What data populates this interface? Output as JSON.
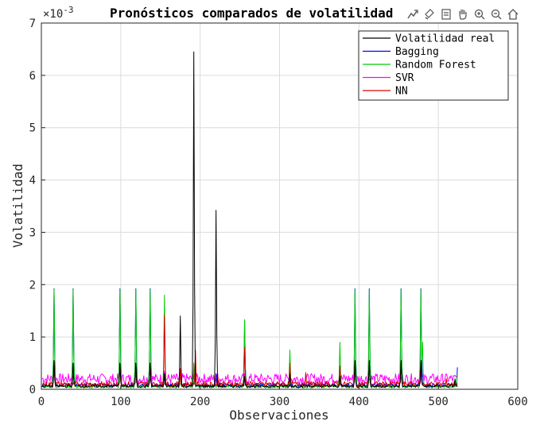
{
  "chart_data": {
    "type": "line",
    "title": "Pronósticos comparados de volatilidad",
    "xlabel": "Observaciones",
    "ylabel": "Volatilidad",
    "exponent_label": "×10",
    "exponent_power": "-3",
    "xlim": [
      0,
      600
    ],
    "ylim": [
      0,
      7
    ],
    "xticks": [
      "0",
      "100",
      "200",
      "300",
      "400",
      "500",
      "600"
    ],
    "yticks": [
      "0",
      "1",
      "2",
      "3",
      "4",
      "5",
      "6",
      "7"
    ],
    "grid": true,
    "legend_position": "top-right",
    "series": [
      {
        "name": "Volatilidad real",
        "color": "#000000",
        "baseline": 0.06,
        "n": 524,
        "spikes": [
          [
            16,
            0.55
          ],
          [
            40,
            0.5
          ],
          [
            99,
            0.5
          ],
          [
            119,
            0.5
          ],
          [
            137,
            0.5
          ],
          [
            155,
            0.3
          ],
          [
            175,
            1.4
          ],
          [
            192,
            6.45
          ],
          [
            220,
            3.42
          ],
          [
            256,
            0.25
          ],
          [
            313,
            0.3
          ],
          [
            376,
            0.25
          ],
          [
            395,
            0.55
          ],
          [
            413,
            0.55
          ],
          [
            453,
            0.55
          ],
          [
            478,
            0.55
          ],
          [
            521,
            0.2
          ]
        ]
      },
      {
        "name": "Bagging",
        "color": "#0000ff",
        "baseline": 0.08,
        "n": 524,
        "spikes": [
          [
            16,
            1.92
          ],
          [
            40,
            1.92
          ],
          [
            99,
            1.92
          ],
          [
            119,
            1.92
          ],
          [
            137,
            1.92
          ],
          [
            155,
            0.3
          ],
          [
            175,
            0.3
          ],
          [
            192,
            0.4
          ],
          [
            220,
            0.3
          ],
          [
            256,
            1.3
          ],
          [
            395,
            1.92
          ],
          [
            413,
            1.92
          ],
          [
            453,
            1.92
          ],
          [
            478,
            1.92
          ],
          [
            524,
            0.42
          ]
        ]
      },
      {
        "name": "Random Forest",
        "color": "#00cc00",
        "baseline": 0.05,
        "n": 524,
        "spikes": [
          [
            16,
            1.9
          ],
          [
            40,
            1.9
          ],
          [
            99,
            1.9
          ],
          [
            119,
            1.9
          ],
          [
            137,
            1.9
          ],
          [
            155,
            1.8
          ],
          [
            175,
            0.3
          ],
          [
            192,
            0.5
          ],
          [
            256,
            1.33
          ],
          [
            313,
            0.75
          ],
          [
            376,
            0.9
          ],
          [
            395,
            1.9
          ],
          [
            413,
            1.9
          ],
          [
            453,
            1.9
          ],
          [
            478,
            1.9
          ],
          [
            480,
            0.9
          ],
          [
            524,
            0.3
          ]
        ]
      },
      {
        "name": "SVR",
        "color": "#ff00ff",
        "baseline": 0.2,
        "n": 524,
        "spikes": [
          [
            16,
            0.3
          ],
          [
            99,
            0.3
          ],
          [
            155,
            0.35
          ],
          [
            256,
            0.3
          ],
          [
            395,
            0.3
          ],
          [
            478,
            0.3
          ]
        ]
      },
      {
        "name": "NN",
        "color": "#dd0000",
        "baseline": 0.1,
        "n": 524,
        "spikes": [
          [
            16,
            0.55
          ],
          [
            99,
            0.5
          ],
          [
            119,
            0.5
          ],
          [
            137,
            0.5
          ],
          [
            155,
            1.42
          ],
          [
            175,
            0.4
          ],
          [
            194,
            0.75
          ],
          [
            222,
            0.3
          ],
          [
            256,
            0.8
          ],
          [
            313,
            0.5
          ],
          [
            333,
            0.32
          ],
          [
            376,
            0.45
          ],
          [
            395,
            0.5
          ],
          [
            413,
            0.5
          ],
          [
            453,
            0.5
          ],
          [
            478,
            0.5
          ],
          [
            510,
            0.2
          ]
        ]
      }
    ]
  },
  "toolbar": {
    "icons": [
      "export-icon",
      "brush-icon",
      "datatip-icon",
      "pan-icon",
      "zoom-in-icon",
      "zoom-out-icon",
      "home-icon"
    ]
  }
}
